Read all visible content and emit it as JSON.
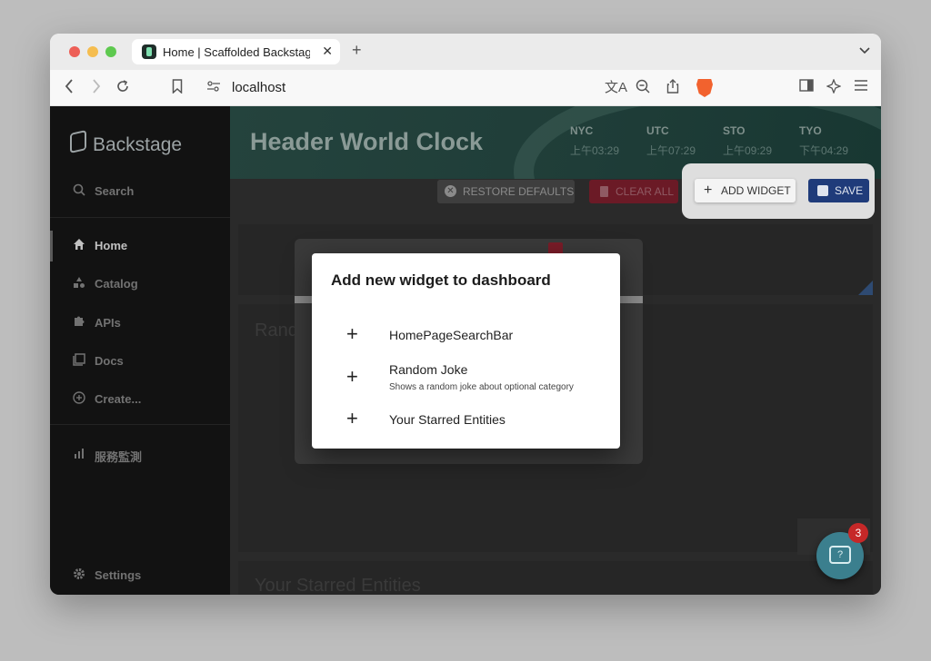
{
  "browser": {
    "tab_title": "Home | Scaffolded Backstage",
    "tab_close": "✕",
    "new_tab": "+",
    "tab_menu": "⌄",
    "url": "localhost"
  },
  "sidebar": {
    "logo": "Backstage",
    "search": "Search",
    "items": [
      {
        "label": "Home",
        "icon": "home-icon"
      },
      {
        "label": "Catalog",
        "icon": "catalog-icon"
      },
      {
        "label": "APIs",
        "icon": "puzzle-icon"
      },
      {
        "label": "Docs",
        "icon": "docs-icon"
      },
      {
        "label": "Create...",
        "icon": "add-circle-icon"
      }
    ],
    "monitor": "服務監測",
    "settings": "Settings"
  },
  "header": {
    "title": "Header World Clock",
    "clocks": [
      {
        "label": "NYC",
        "time": "上午03:29"
      },
      {
        "label": "UTC",
        "time": "上午07:29"
      },
      {
        "label": "STO",
        "time": "上午09:29"
      },
      {
        "label": "TYO",
        "time": "下午04:29"
      }
    ]
  },
  "actions": {
    "restore": "RESTORE DEFAULTS",
    "clear": "CLEAR ALL",
    "add": "ADD WIDGET",
    "save": "SAVE"
  },
  "cards": {
    "random_title": "Rando",
    "starred_title": "Your Starred Entities"
  },
  "dialog": {
    "title": "Add new widget to dashboard",
    "options": [
      {
        "name": "HomePageSearchBar",
        "description": ""
      },
      {
        "name": "Random Joke",
        "description": "Shows a random joke about optional category"
      },
      {
        "name": "Your Starred Entities",
        "description": ""
      }
    ]
  },
  "chat": {
    "badge": "3"
  },
  "colors": {
    "save": "#1f3b7a",
    "clear": "#6b1a26",
    "fab": "#3b7f8e",
    "badge": "#c62828"
  }
}
